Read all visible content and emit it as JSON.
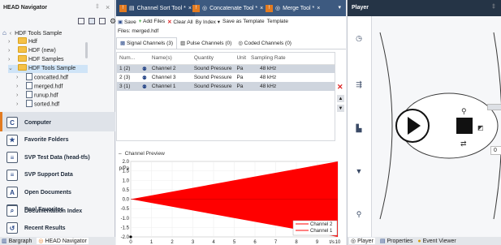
{
  "left": {
    "title": "HEAD Navigator",
    "pin": "‡",
    "close": "×",
    "root_label": "HDF Tools Sample",
    "tree": [
      {
        "label": "Hdf",
        "type": "folder"
      },
      {
        "label": "HDF (new)",
        "type": "folder"
      },
      {
        "label": "HDF Samples",
        "type": "folder"
      },
      {
        "label": "HDF Tools Sample",
        "type": "folder"
      },
      {
        "label": "concatted.hdf",
        "type": "file"
      },
      {
        "label": "merged.hdf",
        "type": "file"
      },
      {
        "label": "runup.hdf",
        "type": "file"
      },
      {
        "label": "sorted.hdf",
        "type": "file"
      }
    ],
    "nav": [
      {
        "label": "Computer",
        "icon": "C"
      },
      {
        "label": "Favorite Folders",
        "icon": "★"
      },
      {
        "label": "SVP Test Data (head-tfs)",
        "icon": "≡"
      },
      {
        "label": "SVP Support Data",
        "icon": "≡"
      },
      {
        "label": "Open Documents",
        "icon": "A"
      },
      {
        "label": "Pool Favorites",
        "icon": "▦"
      },
      {
        "label": "Documentation Index",
        "icon": "⌕"
      },
      {
        "label": "Recent Results",
        "icon": "↺"
      }
    ],
    "bottom_tabs": [
      "Bargraph",
      "HEAD Navigator"
    ]
  },
  "center": {
    "tabs": [
      "Channel Sort Tool *",
      "Concatenate Tool *",
      "Merge Tool *"
    ],
    "toolbar": {
      "save": "Save",
      "add_files": "Add Files",
      "clear_all": "Clear All",
      "by_index": "By Index",
      "save_as_template": "Save as Template",
      "template": "Template"
    },
    "files_label": "Files: merged.hdf",
    "subtabs": [
      "Signal Channels (3)",
      "Pulse Channels (0)",
      "Coded Channels (0)"
    ],
    "columns": [
      "Num...",
      "Name(s)",
      "Quantity",
      "Unit",
      "Sampling Rate"
    ],
    "rows": [
      {
        "num": "1 (2)",
        "name": "Channel 2",
        "quantity": "Sound Pressure",
        "unit": "Pa",
        "rate": "48 kHz"
      },
      {
        "num": "2 (3)",
        "name": "Channel 3",
        "quantity": "Sound Pressure",
        "unit": "Pa",
        "rate": "48 kHz"
      },
      {
        "num": "3 (1)",
        "name": "Channel 1",
        "quantity": "Sound Pressure",
        "unit": "Pa",
        "rate": "48 kHz"
      }
    ],
    "preview_title": "Channel Preview"
  },
  "chart_data": {
    "type": "area",
    "xlabel": "t/s",
    "ylabel": "p/Pa",
    "x_ticks": [
      "0",
      "1",
      "2",
      "3",
      "4",
      "5",
      "6",
      "7",
      "8",
      "9",
      "10"
    ],
    "y_ticks": [
      "2.0",
      "1.5",
      "1.0",
      "0.5",
      "0.0",
      "-0.5",
      "-1.0",
      "-1.5",
      "-2.0"
    ],
    "xlim": [
      0,
      10
    ],
    "ylim": [
      -2,
      2
    ],
    "legend": [
      "Channel 2",
      "Channel 1"
    ],
    "legend_position": "bottom-right",
    "envelope": {
      "x": [
        0,
        10
      ],
      "upper": [
        0,
        2
      ],
      "lower": [
        0,
        -2
      ]
    },
    "fill_color": "#ff0000"
  },
  "right": {
    "title": "Player",
    "value": "0",
    "bottom_tabs": [
      "Player",
      "Properties",
      "Event Viewer"
    ]
  },
  "colors": {
    "accent": "#e27b21",
    "tab_bg": "#3d5a80",
    "panel_header": "#253446",
    "selected": "#cfe4f7"
  }
}
